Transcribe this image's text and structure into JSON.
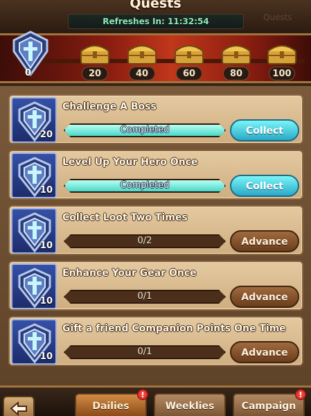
{
  "header": {
    "title": "Quests",
    "refresh_text": "Refreshes In: 11:32:54",
    "side_ghost_text": "Quests"
  },
  "milestones": {
    "current_points": "0",
    "chests": [
      "20",
      "40",
      "60",
      "80",
      "100"
    ],
    "icon": "shield-icon"
  },
  "quests": [
    {
      "name": "Challenge A Boss",
      "reward": "20",
      "progress_text": "Completed",
      "progress": 1.0,
      "action": "Collect",
      "action_type": "collect"
    },
    {
      "name": "Level Up Your Hero Once",
      "reward": "10",
      "progress_text": "Completed",
      "progress": 1.0,
      "action": "Collect",
      "action_type": "collect"
    },
    {
      "name": "Collect Loot Two Times",
      "reward": "10",
      "progress_text": "0/2",
      "progress": 0.0,
      "action": "Advance",
      "action_type": "advance"
    },
    {
      "name": "Enhance Your Gear Once",
      "reward": "10",
      "progress_text": "0/1",
      "progress": 0.0,
      "action": "Advance",
      "action_type": "advance"
    },
    {
      "name": "Gift a friend Companion Points One Time",
      "reward": "10",
      "progress_text": "0/1",
      "progress": 0.0,
      "action": "Advance",
      "action_type": "advance"
    }
  ],
  "nav": {
    "tabs": [
      {
        "label": "Dailies",
        "active": true,
        "alert": "!"
      },
      {
        "label": "Weeklies",
        "active": false,
        "alert": ""
      },
      {
        "label": "Campaign",
        "active": false,
        "alert": "!"
      }
    ],
    "back_icon": "back-arrow-icon"
  },
  "colors": {
    "completed_bar": "#49d7c8",
    "collect_button": "#2aa9c5",
    "advance_button": "#6b3e1c",
    "alert": "#c4140f"
  }
}
